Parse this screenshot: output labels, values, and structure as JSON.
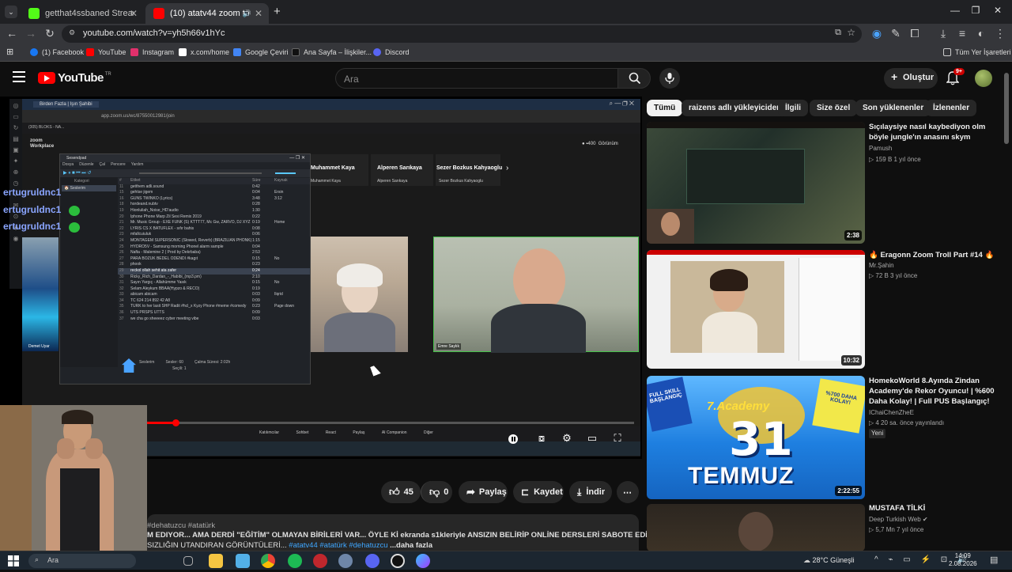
{
  "browser": {
    "tabs": [
      {
        "title": "getthat4ssbaned Stream - Kick",
        "favicon_color": "#53fc18"
      },
      {
        "title": "(10) atatv44 zoom troll - Yo",
        "favicon_color": "#ff0000"
      }
    ],
    "url": "youtube.com/watch?v=yh5h66v1hYc",
    "bookmarks": [
      {
        "label": "(1) Facebook",
        "color": "#1877f2"
      },
      {
        "label": "YouTube",
        "color": "#ff0000"
      },
      {
        "label": "Instagram",
        "color": "#e1306c"
      },
      {
        "label": "x.com/home",
        "color": "#ffffff"
      },
      {
        "label": "Google Çeviri",
        "color": "#4285f4"
      },
      {
        "label": "Ana Sayfa – İlişkiler...",
        "color": "#111111"
      },
      {
        "label": "Discord",
        "color": "#5865f2"
      }
    ],
    "all_bookmarks_label": "Tüm Yer İşaretleri"
  },
  "youtube": {
    "logo_text": "YouTube",
    "logo_sup": "TR",
    "search_placeholder": "Ara",
    "create_label": "Oluştur",
    "notif_count": "9+"
  },
  "player": {
    "zoom_brand": "zoom\nWorkplace",
    "zoom_url": "app.zoom.us/wc/87550012981/join",
    "zoom_tab": "Birden Fazla | Işın Şahibi",
    "zoom_tab2": "(305) BLOKS - NA...",
    "participants_top": [
      "Muhammet Kaya",
      "Alperen Sarıkaya",
      "Sezer Bozkus Kahyaoglu"
    ],
    "participant_labels": [
      "Demet Uyar",
      "Emre Saylık"
    ],
    "zoom_view_label": "Görünüm",
    "music_player_title": "Sesendpad",
    "music_menu": [
      "Dosya",
      "Düzenle",
      "Çal",
      "Pencere",
      "Yardım"
    ],
    "music_sidebar_label": "Kategori",
    "music_sidebar_item": "Seslerim",
    "music_headers": [
      "#",
      "Etiket",
      "Süre",
      "Kaynak"
    ],
    "music_rows": [
      {
        "n": "11",
        "t": "getthem adli.sound",
        "d": "0:42",
        "a": ""
      },
      {
        "n": "15",
        "t": "gehtse jigem",
        "d": "0:04",
        "a": "Ersin"
      },
      {
        "n": "16",
        "t": "GUNS TWINKO (Lyrics)",
        "d": "3:48",
        "a": "3:12"
      },
      {
        "n": "18",
        "t": "hordeand.nubtv",
        "d": "0:28",
        "a": ""
      },
      {
        "n": "19",
        "t": "Hionluliah_Noise_HD'audio",
        "d": "1:30",
        "a": ""
      },
      {
        "n": "20",
        "t": "Iphone Phone Marp Zil Sesi Remix 2019",
        "d": "0:22",
        "a": ""
      },
      {
        "n": "21",
        "t": "Mr. Music Group - EXE FUNK (S) KTTT77, Mc Gw, ZARVO, DJ XYZ",
        "d": "0:19",
        "a": "Home"
      },
      {
        "n": "22",
        "t": "LYRIS CS X BATUFLEX - sıfır bahis",
        "d": "0:08",
        "a": ""
      },
      {
        "n": "23",
        "t": "mfallcuiuluk",
        "d": "0:06",
        "a": ""
      },
      {
        "n": "24",
        "t": "MONTAGEM SUPERSONIC (Slowed, Reverb) (BRAZILIAN PHONK)",
        "d": "1:15",
        "a": ""
      },
      {
        "n": "25",
        "t": "HYDRO5V - Samsung morning Phonel alarm sample",
        "d": "0:04",
        "a": ""
      },
      {
        "n": "26",
        "t": "Nafta - Malemine 2 ( Prod by Dekrbaba)",
        "d": "2:53",
        "a": ""
      },
      {
        "n": "27",
        "t": "PARA BOZUK BEDEL ODENDI #kagıt",
        "d": "0:15",
        "a": "No"
      },
      {
        "n": "28",
        "t": "phook",
        "d": "0:23",
        "a": ""
      },
      {
        "n": "29",
        "t": "reckol ollah sehit ata zafer",
        "d": "0:24",
        "a": ""
      },
      {
        "n": "30",
        "t": "Ricky_Rich_Dardan_-_Habibi_(mp3.pm)",
        "d": "2:10",
        "a": ""
      },
      {
        "n": "31",
        "t": "Sayın Yargıç - Allahümme Yasık",
        "d": "0:15",
        "a": "No"
      },
      {
        "n": "32",
        "t": "Selam Aleykum BBAA(Hypzo & RECO)",
        "d": "0:19",
        "a": ""
      },
      {
        "n": "33",
        "t": "abicam abicam",
        "d": "0:03",
        "a": "Ilqrid"
      },
      {
        "n": "34",
        "t": "TC 624 214 892 42 A8",
        "d": "0:09",
        "a": ""
      },
      {
        "n": "35",
        "t": "TÜRK to her lasit SHP Radit #hcl_x Kyzy Phone #meme #comedy",
        "d": "0:23",
        "a": "Page down"
      },
      {
        "n": "36",
        "t": "UTS PRSPS UTTS",
        "d": "0:09",
        "a": ""
      },
      {
        "n": "37",
        "t": "we cha go sheeeez cyber meeting vibe",
        "d": "0:03",
        "a": ""
      }
    ],
    "music_selected_index": 14,
    "music_footer": [
      "Seslerim",
      "Sesler: 60",
      "Çalma Süresi: 2:02h",
      "Seçili: 1"
    ],
    "chat_names": [
      "ertugruldnc1",
      "ertugruldnc1",
      "ertugruldnc1"
    ],
    "zoom_controls": [
      "Katılımcılar",
      "Sohbet",
      "React",
      "Paylaş",
      "AI Companion",
      "Diğer"
    ],
    "progress_fraction": 0.06
  },
  "actions": {
    "likes": "45",
    "dislikes": "0",
    "share": "Paylaş",
    "save": "Kaydet",
    "download": "İndir"
  },
  "description": {
    "tags_top": "#dehatuzcu #atatürk",
    "line1": "M EDIYOR... AMA DERDİ \"EĞİTİM\" OLMAYAN BİRİLERİ VAR... ÖYLE Kİ ekranda s1kleriyle ANSIZIN BELİRİP ONLİNE DERSLERİ SABOTE EDİYORLAR...",
    "line2_text": "SIZLIĞIN UTANDIRAN GÖRÜNTÜLERİ...",
    "line2_tags": "#atatv44 #atatürk #dehatuzcu",
    "more": "...daha fazla"
  },
  "chips": [
    "Tümü",
    "raizens adlı yükleyiciden",
    "İlgili",
    "Size özel",
    "Son yüklenenler",
    "İzlenenler"
  ],
  "recommendations": [
    {
      "title": "Sıçılaysiye nasıl kaybediyon olm böyle jungle'ın anasını skym",
      "channel": "Pamush",
      "stats": "▷ 159 B  1 yıl önce",
      "duration": "2:38"
    },
    {
      "title": "🔥 Eragonn  Zoom Troll Part #14 🔥",
      "channel": "Mr.Şahin",
      "stats": "▷ 72 B  3 yıl önce",
      "duration": "10:32"
    },
    {
      "title": "HomekoWorld 8.Ayında Zindan Academy'de Rekor Oyuncu! | %600 Daha Kolay! | Full PUS Başlangıç!",
      "channel": "IChaiChenZheE",
      "stats": "▷ 4  20 sa. önce yayınlandı",
      "badge": "Yeni",
      "duration": "2:22:55"
    },
    {
      "title": "MUSTAFA TİLKİ",
      "channel": "Deep Turkish Web ✔",
      "stats": "▷ 5,7 Mn  7 yıl önce",
      "duration": ""
    }
  ],
  "thumb3_text": {
    "big": "31",
    "word": "TEMMUZ",
    "tag1": "FULL SKILL BAŞLANGIÇ",
    "tag2": "%700 DAHA KOLAY!",
    "brand": "7.Academy"
  },
  "taskbar": {
    "search": "Ara",
    "weather": "28°C  Güneşli",
    "time": "14:09",
    "date": "2.08.2026"
  }
}
